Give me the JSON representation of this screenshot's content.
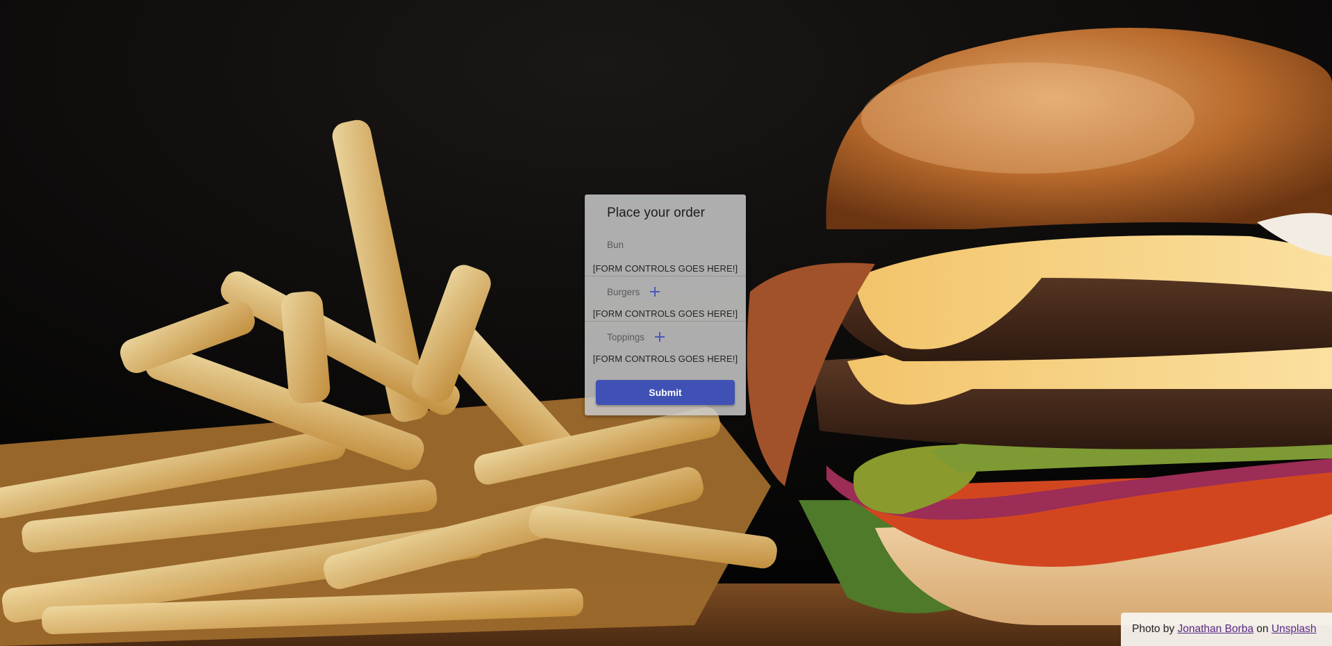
{
  "card": {
    "title": "Place your order",
    "sections": [
      {
        "label": "Bun",
        "has_add": false,
        "placeholder": "[FORM CONTROLS GOES HERE!]"
      },
      {
        "label": "Burgers",
        "has_add": true,
        "placeholder": "[FORM CONTROLS GOES HERE!]"
      },
      {
        "label": "Toppings",
        "has_add": true,
        "placeholder": "[FORM CONTROLS GOES HERE!]"
      }
    ],
    "submit_label": "Submit",
    "add_icon": "plus-icon"
  },
  "credit": {
    "prefix": "Photo by",
    "author": "Jonathan Borba",
    "joiner": "on",
    "site": "Unsplash"
  },
  "colors": {
    "primary": "#3f51b5",
    "card_bg": "#c8c8c8",
    "link": "#5b2a86"
  }
}
